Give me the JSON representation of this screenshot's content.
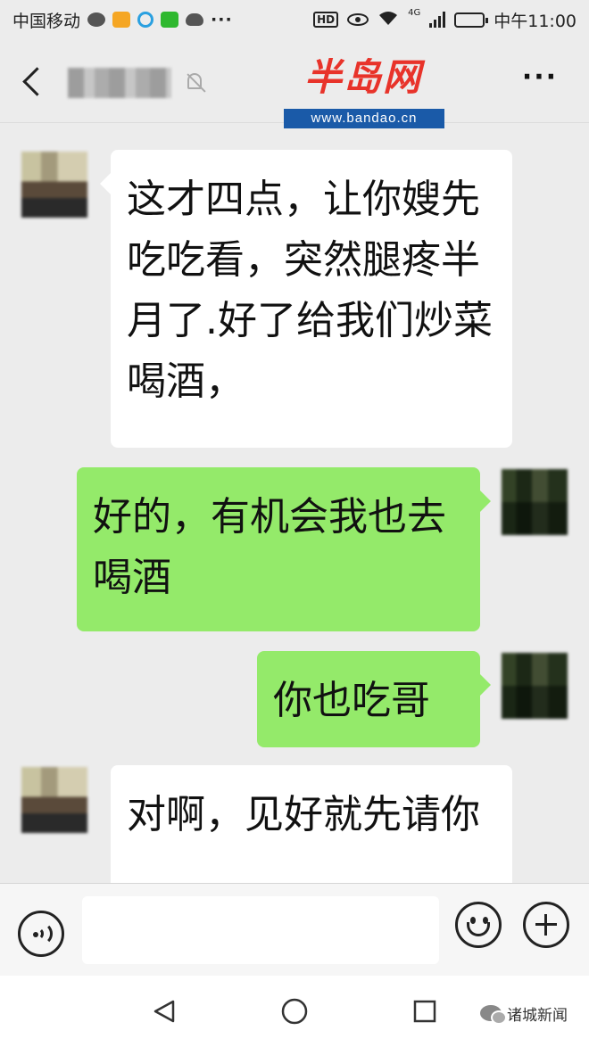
{
  "status_bar": {
    "carrier": "中国移动",
    "network": "4G",
    "hd_label": "HD",
    "time": "中午11:00",
    "more": "···",
    "battery_level": 0.8
  },
  "header": {
    "contact_name": " ",
    "back_icon": "chevron-left-icon",
    "mute_icon": "bell-slash-icon",
    "more_label": "···"
  },
  "watermark": {
    "logo_text": "半岛网",
    "url": "www.bandao.cn",
    "color": "#e8332a",
    "url_bg": "#1a5aa8"
  },
  "messages": [
    {
      "side": "left",
      "text": "这才四点，让你嫂先吃吃看，突然腿疼半月了.好了给我们炒菜喝酒，"
    },
    {
      "side": "right",
      "text": "好的，有机会我也去喝酒"
    },
    {
      "side": "right",
      "text": "你也吃哥"
    },
    {
      "side": "left",
      "text": "对啊，见好就先请你"
    }
  ],
  "input_bar": {
    "value": "",
    "voice_icon": "voice-icon",
    "emoji_icon": "emoji-icon",
    "plus_icon": "plus-icon"
  },
  "nav_bar": {
    "back_icon": "triangle-back-icon",
    "home_icon": "circle-home-icon",
    "recent_icon": "square-recent-icon"
  },
  "source_tag": {
    "label": "诸城新闻",
    "icon": "wechat-icon"
  },
  "colors": {
    "background": "#ececec",
    "bubble_sent": "#94ea6a",
    "bubble_received": "#ffffff"
  }
}
